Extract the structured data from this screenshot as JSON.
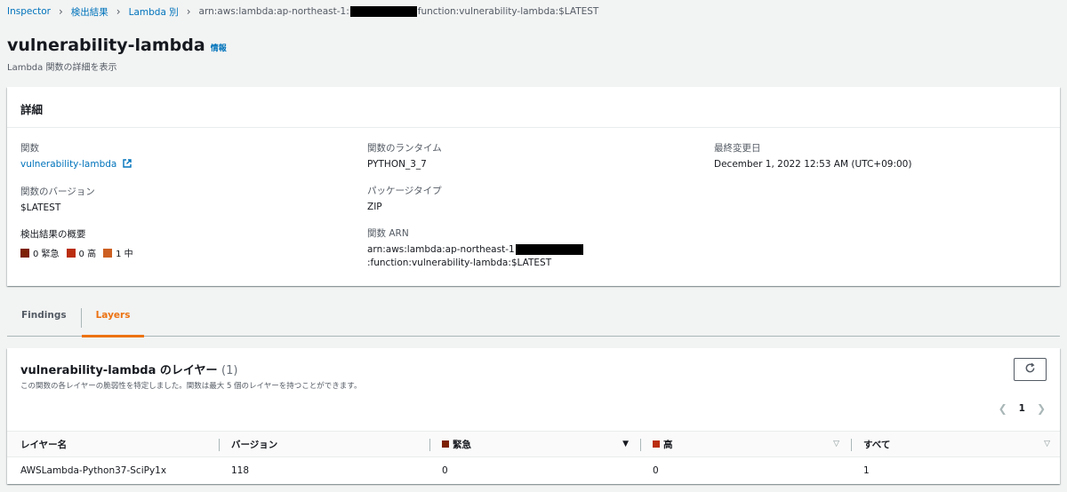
{
  "breadcrumb": {
    "items": [
      "Inspector",
      "検出結果",
      "Lambda 別"
    ],
    "current_prefix": "arn:aws:lambda:ap-northeast-1:",
    "current_suffix": "function:vulnerability-lambda:$LATEST"
  },
  "header": {
    "title": "vulnerability-lambda",
    "info_label": "情報",
    "subtitle": "Lambda 関数の詳細を表示"
  },
  "details": {
    "title": "詳細",
    "function_label": "関数",
    "function_value": "vulnerability-lambda",
    "runtime_label": "関数のランタイム",
    "runtime_value": "PYTHON_3_7",
    "modified_label": "最終変更日",
    "modified_value": "December 1, 2022 12:53 AM (UTC+09:00)",
    "version_label": "関数のバージョン",
    "version_value": "$LATEST",
    "package_label": "パッケージタイプ",
    "package_value": "ZIP",
    "summary_label": "検出結果の概要",
    "severities": [
      {
        "label": "0 緊急",
        "color": "#7d2105"
      },
      {
        "label": "0 高",
        "color": "#ba2e0f"
      },
      {
        "label": "1 中",
        "color": "#cc5f21"
      }
    ],
    "arn_label": "関数 ARN",
    "arn_prefix": "arn:aws:lambda:ap-northeast-1",
    "arn_suffix": ":function:vulnerability-lambda:$LATEST"
  },
  "tabs": [
    {
      "label": "Findings",
      "active": false
    },
    {
      "label": "Layers",
      "active": true
    }
  ],
  "layers": {
    "title": "vulnerability-lambda のレイヤー",
    "count": "(1)",
    "description": "この関数の各レイヤーの脆弱性を特定しました。関数は最大 5 個のレイヤーを持つことができます。",
    "page": "1",
    "columns": [
      "レイヤー名",
      "バージョン",
      "緊急",
      "高",
      "すべて"
    ],
    "rows": [
      [
        "AWSLambda-Python37-SciPy1x",
        "118",
        "0",
        "0",
        "1"
      ]
    ]
  },
  "colors": {
    "link": "#0073bb",
    "accent": "#ec7211",
    "critical": "#7d2105",
    "high": "#ba2e0f",
    "medium": "#cc5f21"
  },
  "icons": [
    "chevron-right-icon",
    "external-link-icon",
    "refresh-icon",
    "chevron-left-icon",
    "sort-caret-icon"
  ]
}
